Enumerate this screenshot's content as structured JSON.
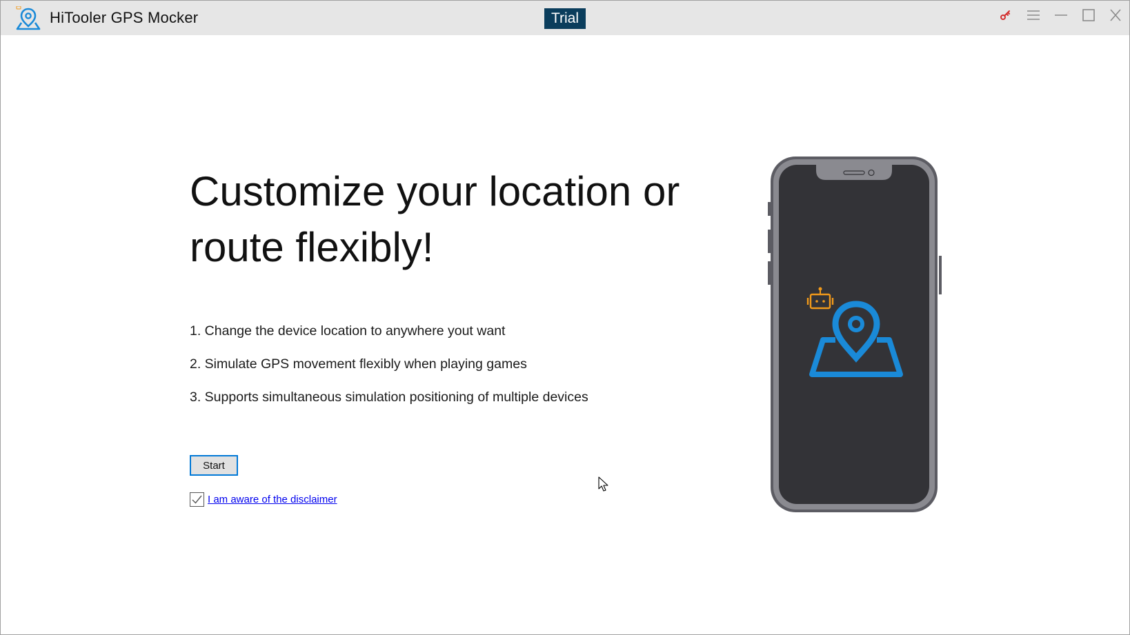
{
  "window": {
    "title": "HiTooler GPS Mocker",
    "badge": "Trial",
    "controls": [
      "key-icon",
      "menu-icon",
      "minimize-icon",
      "maximize-icon",
      "close-icon"
    ]
  },
  "hero": {
    "title": "Customize your location or route flexibly!"
  },
  "features": [
    "1. Change the device location to anywhere yout want",
    "2. Simulate GPS movement flexibly when playing games",
    "3. Supports simultaneous simulation positioning of multiple devices"
  ],
  "actions": {
    "start_label": "Start",
    "disclaimer_label": "I am aware of the disclaimer",
    "disclaimer_checked": true
  },
  "illustration": {
    "icons": [
      "phone-illustration",
      "robot-icon",
      "location-pin-icon"
    ]
  },
  "colors": {
    "accent_blue": "#1a8ad8",
    "robot_orange": "#f29a1a",
    "badge_bg": "#0a3d5c",
    "key_red": "#d32f2f",
    "phone_screen": "#333337",
    "phone_frame": "#5c5c63"
  }
}
